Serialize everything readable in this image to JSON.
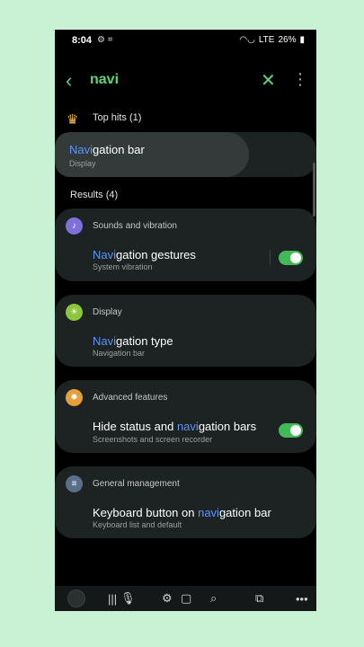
{
  "status_bar": {
    "time": "8:04",
    "icons_left": "⚙ ⌗",
    "battery": "26%",
    "network": "LTE"
  },
  "search": {
    "query": "navi",
    "back_icon": "back-arrow-icon",
    "clear_icon": "close-icon",
    "more_icon": "more-vert-icon"
  },
  "top_hits": {
    "label": "Top hits (1)",
    "item": {
      "title_match": "Navi",
      "title_rest": "gation bar",
      "subtitle": "Display"
    }
  },
  "results": {
    "label": "Results (4)"
  },
  "cards": [
    {
      "category": "Sounds and vibration",
      "color": "#7f6fd8",
      "title_pre": "",
      "title_match": "Navi",
      "title_rest": "gation gestures",
      "subtitle": "System vibration",
      "toggle": true
    },
    {
      "category": "Display",
      "color": "#8ac73a",
      "title_pre": "",
      "title_match": "Navi",
      "title_rest": "gation type",
      "subtitle": "Navigation bar",
      "toggle": false
    },
    {
      "category": "Advanced features",
      "color": "#e5a03a",
      "title_pre": "Hide status and ",
      "title_match": "navi",
      "title_rest": "gation bars",
      "subtitle": "Screenshots and screen recorder",
      "toggle": true
    },
    {
      "category": "General management",
      "color": "#5a6f8a",
      "title_pre": "Keyboard button on ",
      "title_match": "navi",
      "title_rest": "gation bar",
      "subtitle": "Keyboard list and default",
      "toggle": false
    }
  ]
}
